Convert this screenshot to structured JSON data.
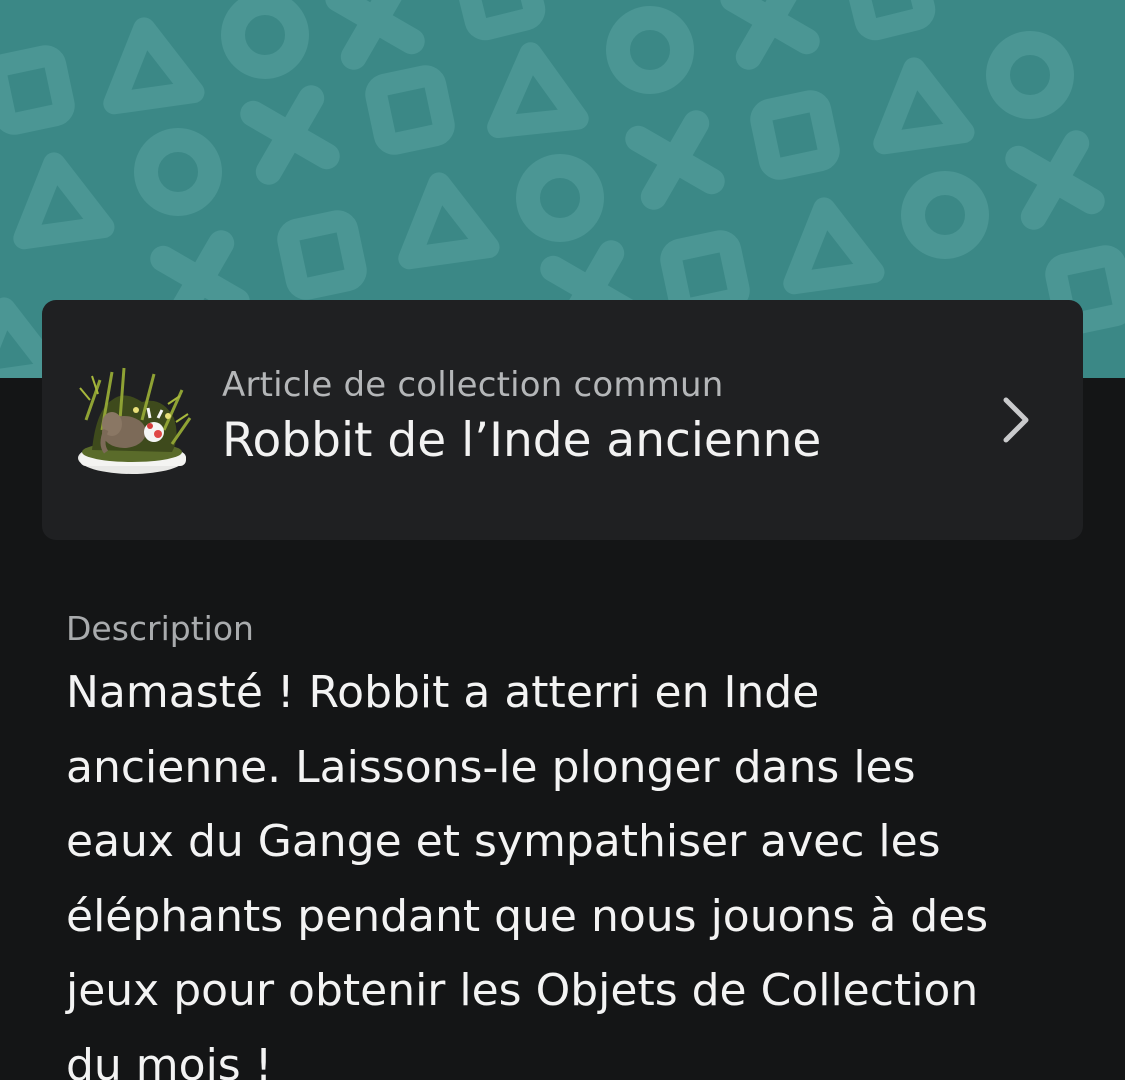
{
  "header": {
    "background_color": "#3b8886",
    "pattern_color": "#4b9694",
    "pattern_icons": [
      "triangle-icon",
      "circle-icon",
      "cross-icon",
      "square-icon"
    ]
  },
  "item_card": {
    "thumbnail_icon": "diorama-robbit-elephant-icon",
    "subtitle": "Article de collection commun",
    "title": "Robbit de l’Inde ancienne",
    "chevron_icon": "chevron-right-icon"
  },
  "description": {
    "label": "Description",
    "lines": [
      "Namasté ! Robbit a atterri en Inde",
      "ancienne. Laissons-le plonger dans les",
      "eaux du Gange et sympathiser avec les",
      "éléphants pendant que nous jouons à des",
      "jeux pour obtenir les Objets de Collection",
      "du mois !"
    ]
  },
  "colors": {
    "page_background": "#141516",
    "card_background": "#1f2022",
    "primary_text": "#f2f2f2",
    "secondary_text": "#b4b6b8"
  }
}
